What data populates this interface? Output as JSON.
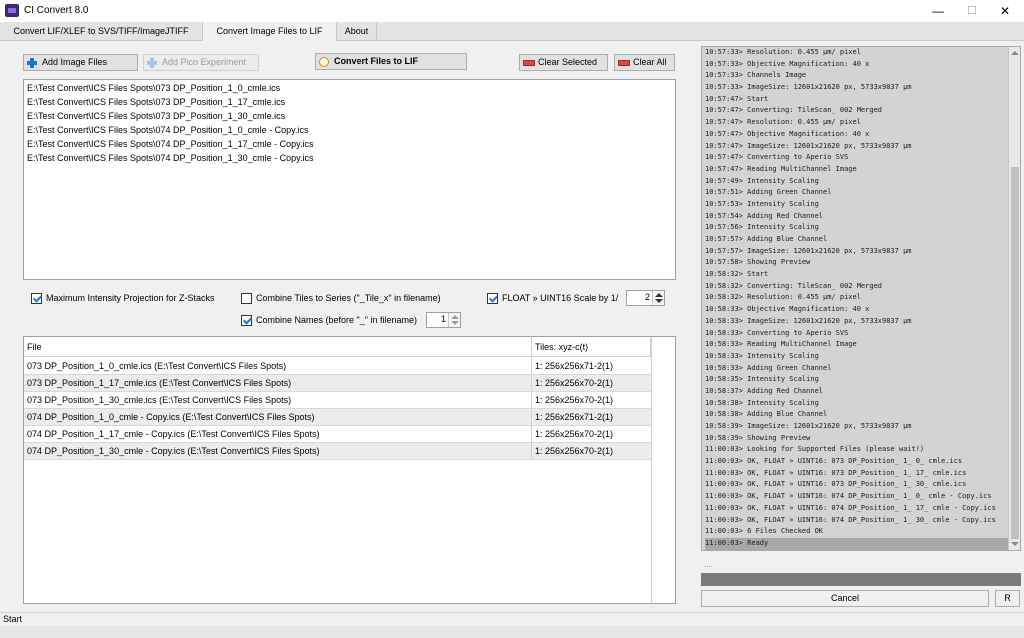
{
  "window": {
    "title": "CI Convert 8.0",
    "minimize": "—",
    "maximize": "☐",
    "close": "✕"
  },
  "tabs": [
    {
      "label": "Convert LIF/XLEF to SVS/TIFF/ImageJTIFF",
      "active": false
    },
    {
      "label": "Convert Image Files to LIF",
      "active": true
    },
    {
      "label": "About",
      "active": false
    }
  ],
  "toolbar": {
    "add_image_files": "Add Image Files",
    "add_pico_experiment": "Add Pico Experiment",
    "convert_files": "Convert Files to LIF",
    "clear_selected": "Clear Selected",
    "clear_all": "Clear All"
  },
  "input_files": [
    "E:\\Test Convert\\ICS Files Spots\\073 DP_Position_1_0_cmle.ics",
    "E:\\Test Convert\\ICS Files Spots\\073 DP_Position_1_17_cmle.ics",
    "E:\\Test Convert\\ICS Files Spots\\073 DP_Position_1_30_cmle.ics",
    "E:\\Test Convert\\ICS Files Spots\\074 DP_Position_1_0_cmle - Copy.ics",
    "E:\\Test Convert\\ICS Files Spots\\074 DP_Position_1_17_cmle - Copy.ics",
    "E:\\Test Convert\\ICS Files Spots\\074 DP_Position_1_30_cmle - Copy.ics"
  ],
  "options": {
    "max_projection": {
      "label": "Maximum Intensity Projection for Z-Stacks",
      "checked": true
    },
    "combine_tiles": {
      "label": "Combine Tiles to Series (\"_Tile_x\" in filename)",
      "checked": false
    },
    "float_scale": {
      "label": "FLOAT » UINT16 Scale by 1/",
      "checked": true,
      "value": "2"
    },
    "combine_names": {
      "label": "Combine Names (before \"_\" in filename)",
      "checked": true,
      "value": "1"
    }
  },
  "file_table": {
    "columns": [
      "File",
      "Tiles: xyz-c(t)"
    ],
    "rows": [
      [
        "073 DP_Position_1_0_cmle.ics (E:\\Test Convert\\ICS Files Spots)",
        "1: 256x256x71-2(1)"
      ],
      [
        "073 DP_Position_1_17_cmle.ics (E:\\Test Convert\\ICS Files Spots)",
        "1: 256x256x70-2(1)"
      ],
      [
        "073 DP_Position_1_30_cmle.ics (E:\\Test Convert\\ICS Files Spots)",
        "1: 256x256x70-2(1)"
      ],
      [
        "074 DP_Position_1_0_cmle - Copy.ics (E:\\Test Convert\\ICS Files Spots)",
        "1: 256x256x71-2(1)"
      ],
      [
        "074 DP_Position_1_17_cmle - Copy.ics (E:\\Test Convert\\ICS Files Spots)",
        "1: 256x256x70-2(1)"
      ],
      [
        "074 DP_Position_1_30_cmle - Copy.ics (E:\\Test Convert\\ICS Files Spots)",
        "1: 256x256x70-2(1)"
      ]
    ]
  },
  "log": [
    "10:57:33> Resolution: 0.455 µm/ pixel",
    "10:57:33> Objective Magnification: 40 x",
    "10:57:33> Channels Image",
    "10:57:33> ImageSize: 12601x21620 px, 5733x9837 µm",
    "10:57:47> Start",
    "10:57:47> Converting: TileScan_ 002 Merged",
    "10:57:47> Resolution: 0.455 µm/ pixel",
    "10:57:47> Objective Magnification: 40 x",
    "10:57:47> ImageSize: 12601x21620 px, 5733x9837 µm",
    "10:57:47> Converting to Aperio SVS",
    "10:57:47> Reading MultiChannel Image",
    "10:57:49> Intensity Scaling",
    "10:57:51> Adding Green Channel",
    "10:57:53> Intensity Scaling",
    "10:57:54> Adding Red Channel",
    "10:57:56> Intensity Scaling",
    "10:57:57> Adding Blue Channel",
    "10:57:57> ImageSize: 12601x21620 px, 5733x9837 µm",
    "10:57:58> Showing Preview",
    "10:58:32> Start",
    "10:58:32> Converting: TileScan_ 002 Merged",
    "10:58:32> Resolution: 0.455 µm/ pixel",
    "10:58:33> Objective Magnification: 40 x",
    "10:58:33> ImageSize: 12601x21620 px, 5733x9837 µm",
    "10:58:33> Converting to Aperio SVS",
    "10:58:33> Reading MultiChannel Image",
    "10:58:33> Intensity Scaling",
    "10:58:33> Adding Green Channel",
    "10:58:35> Intensity Scaling",
    "10:58:37> Adding Red Channel",
    "10:58:38> Intensity Scaling",
    "10:58:38> Adding Blue Channel",
    "10:58:39> ImageSize: 12601x21620 px, 5733x9837 µm",
    "10:58:39> Showing Preview",
    "11:00:03> Looking for Supported Files (please wait!)",
    "11:00:03> OK, FLOAT » UINT16: 073 DP_Position_ 1_ 0_ cmle.ics",
    "11:00:03> OK, FLOAT » UINT16: 073 DP_Position_ 1_ 17_ cmle.ics",
    "11:00:03> OK, FLOAT » UINT16: 073 DP_Position_ 1_ 30_ cmle.ics",
    "11:00:03> OK, FLOAT » UINT16: 074 DP_Position_ 1_ 0_ cmle - Copy.ics",
    "11:00:03> OK, FLOAT » UINT16: 074 DP_Position_ 1_ 17_ cmle - Copy.ics",
    "11:00:03> OK, FLOAT » UINT16: 074 DP_Position_ 1_ 30_ cmle - Copy.ics",
    "11:00:03> 6 Files Checked OK",
    "11:00:03> Ready"
  ],
  "log_selected_index": 42,
  "progress_status": "....",
  "buttons": {
    "cancel": "Cancel",
    "r": "R"
  },
  "statusbar": {
    "text": "Start"
  }
}
